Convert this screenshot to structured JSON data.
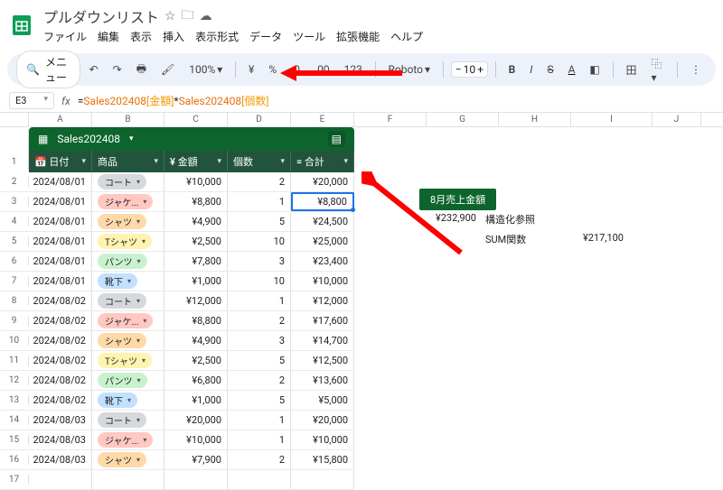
{
  "doc": {
    "title": "プルダウンリスト",
    "menus": [
      "ファイル",
      "編集",
      "表示",
      "挿入",
      "表示形式",
      "データ",
      "ツール",
      "拡張機能",
      "ヘルプ"
    ]
  },
  "toolbar": {
    "menu_label": "メニュー",
    "zoom": "100%",
    "font": "Roboto",
    "font_size": "10",
    "yen": "¥",
    "pct": "%",
    "num": "123"
  },
  "formula": {
    "cell_ref": "E3",
    "prefix": "=",
    "r1": "Sales202408",
    "b1": "[金額]",
    "op": "*",
    "r2": "Sales202408",
    "b2": "[個数]"
  },
  "cols": [
    "A",
    "B",
    "C",
    "D",
    "E",
    "F",
    "G",
    "H",
    "I",
    "J"
  ],
  "table": {
    "name": "Sales202408",
    "headers": [
      "日付",
      "商品",
      "金額",
      "個数",
      "合計"
    ],
    "rows": [
      {
        "n": 2,
        "date": "2024/08/01",
        "prod": "コート",
        "chip": "#d6d9dc",
        "amt": "¥10,000",
        "qty": "2",
        "total": "¥20,000"
      },
      {
        "n": 3,
        "date": "2024/08/01",
        "prod": "ジャケ...",
        "chip": "#ffc8c1",
        "amt": "¥8,800",
        "qty": "1",
        "total": "¥8,800"
      },
      {
        "n": 4,
        "date": "2024/08/01",
        "prod": "シャツ",
        "chip": "#ffd9a8",
        "amt": "¥4,900",
        "qty": "5",
        "total": "¥24,500"
      },
      {
        "n": 5,
        "date": "2024/08/01",
        "prod": "Tシャツ",
        "chip": "#fff3b0",
        "amt": "¥2,500",
        "qty": "10",
        "total": "¥25,000"
      },
      {
        "n": 6,
        "date": "2024/08/01",
        "prod": "パンツ",
        "chip": "#c8f2cd",
        "amt": "¥7,800",
        "qty": "3",
        "total": "¥23,400"
      },
      {
        "n": 7,
        "date": "2024/08/01",
        "prod": "靴下",
        "chip": "#c2e0ff",
        "amt": "¥1,000",
        "qty": "10",
        "total": "¥10,000"
      },
      {
        "n": 8,
        "date": "2024/08/02",
        "prod": "コート",
        "chip": "#d6d9dc",
        "amt": "¥12,000",
        "qty": "1",
        "total": "¥12,000"
      },
      {
        "n": 9,
        "date": "2024/08/02",
        "prod": "ジャケ...",
        "chip": "#ffc8c1",
        "amt": "¥8,800",
        "qty": "2",
        "total": "¥17,600"
      },
      {
        "n": 10,
        "date": "2024/08/02",
        "prod": "シャツ",
        "chip": "#ffd9a8",
        "amt": "¥4,900",
        "qty": "3",
        "total": "¥14,700"
      },
      {
        "n": 11,
        "date": "2024/08/02",
        "prod": "Tシャツ",
        "chip": "#fff3b0",
        "amt": "¥2,500",
        "qty": "5",
        "total": "¥12,500"
      },
      {
        "n": 12,
        "date": "2024/08/02",
        "prod": "パンツ",
        "chip": "#c8f2cd",
        "amt": "¥6,800",
        "qty": "2",
        "total": "¥13,600"
      },
      {
        "n": 13,
        "date": "2024/08/02",
        "prod": "靴下",
        "chip": "#c2e0ff",
        "amt": "¥1,000",
        "qty": "5",
        "total": "¥5,000"
      },
      {
        "n": 14,
        "date": "2024/08/03",
        "prod": "コート",
        "chip": "#d6d9dc",
        "amt": "¥20,000",
        "qty": "1",
        "total": "¥20,000"
      },
      {
        "n": 15,
        "date": "2024/08/03",
        "prod": "ジャケ...",
        "chip": "#ffc8c1",
        "amt": "¥10,000",
        "qty": "1",
        "total": "¥10,000"
      },
      {
        "n": 16,
        "date": "2024/08/03",
        "prod": "シャツ",
        "chip": "#ffd9a8",
        "amt": "¥7,900",
        "qty": "2",
        "total": "¥15,800"
      }
    ]
  },
  "side": {
    "title": "8月売上金額",
    "val1": "¥232,900",
    "lbl1": "構造化参照",
    "lbl2": "SUM関数",
    "val2": "¥217,100"
  }
}
